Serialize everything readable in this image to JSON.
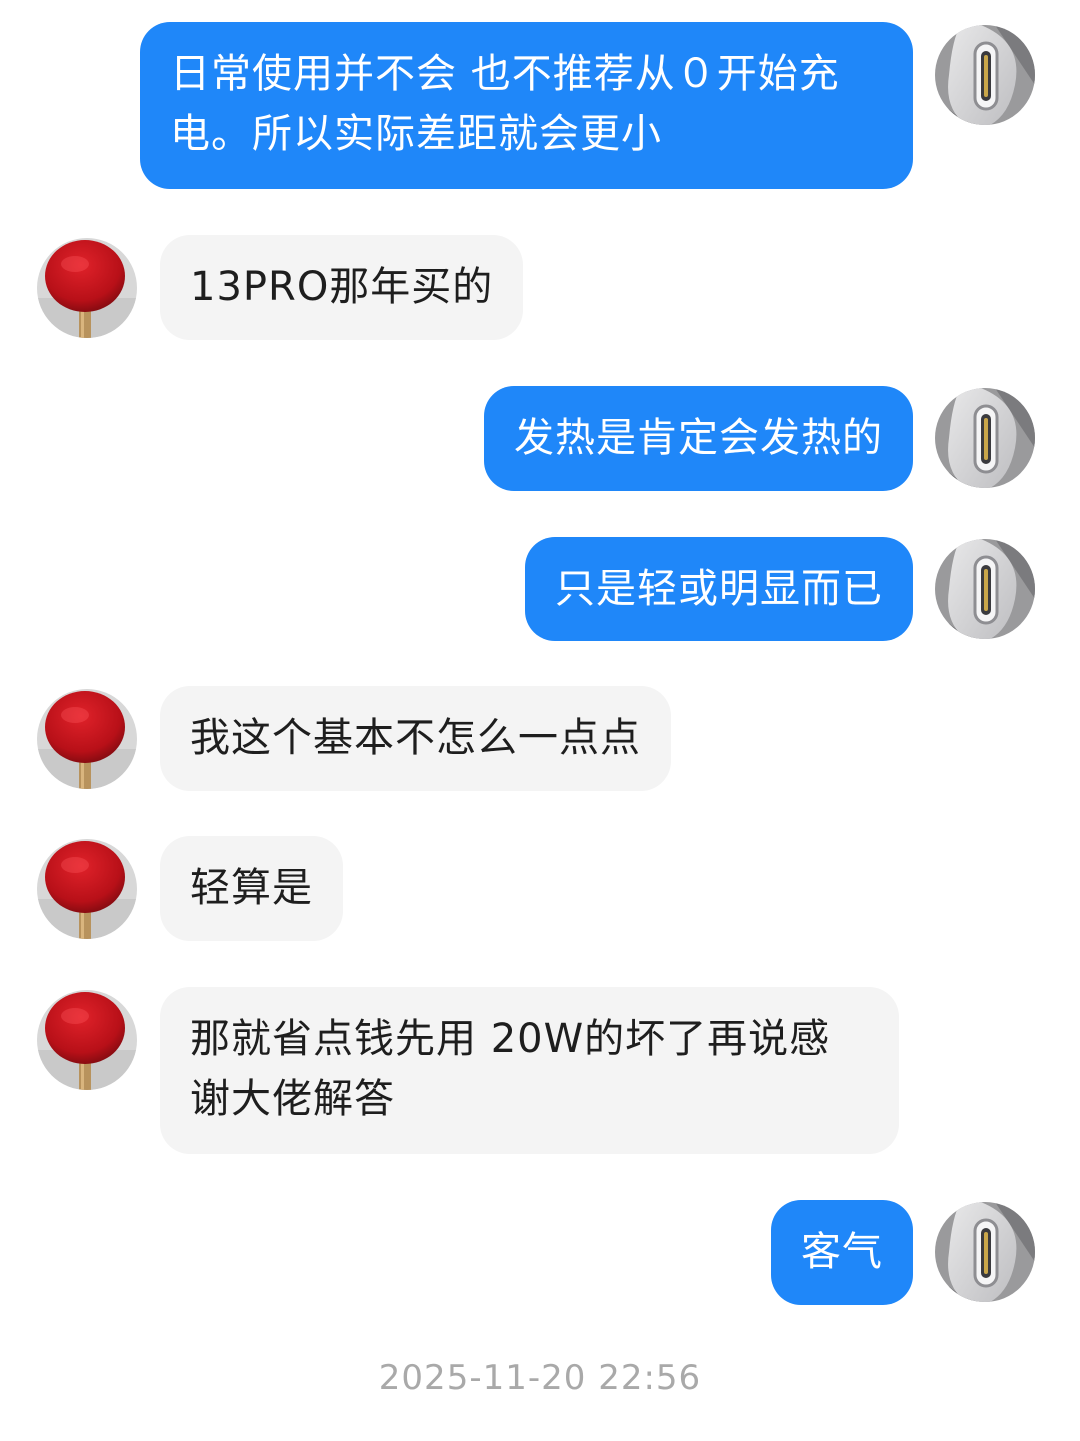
{
  "messages": [
    {
      "sender": "me",
      "text": "日常使用并不会 也不推荐从０开始充电。所以实际差距就会更小"
    },
    {
      "sender": "other",
      "text": "13PRO那年买的"
    },
    {
      "sender": "me",
      "text": "发热是肯定会发热的"
    },
    {
      "sender": "me",
      "text": "只是轻或明显而已"
    },
    {
      "sender": "other",
      "text": "我这个基本不怎么一点点"
    },
    {
      "sender": "other",
      "text": "轻算是"
    },
    {
      "sender": "other",
      "text": "那就省点钱先用 20W的坏了再说感谢大佬解答"
    },
    {
      "sender": "me",
      "text": "客气"
    }
  ],
  "timestamp": "2025-11-20 22:56",
  "colors": {
    "my_bubble": "#1f87f9",
    "other_bubble": "#f4f4f4",
    "timestamp": "#a9a9a9"
  },
  "icons": {
    "my_avatar": "usb-c-port-icon",
    "other_avatar": "ping-pong-paddle-icon"
  }
}
